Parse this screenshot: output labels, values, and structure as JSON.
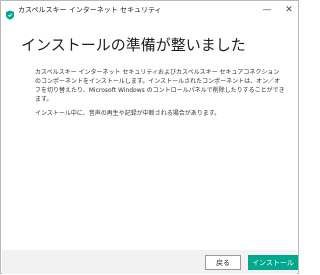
{
  "window": {
    "title": "カスペルスキー インターネット セキュリティ",
    "minimize_glyph": "—",
    "close_glyph": "✕"
  },
  "content": {
    "heading": "インストールの準備が整いました",
    "paragraph1": "カスペルスキー インターネット セキュリティおよびカスペルスキー セキュアコネクションのコンポーネントをインストールします。インストールされたコンポーネントは、オン／オフを切り替えたり、Microsoft Windows のコントロールパネルで削除したりすることができます。",
    "paragraph2": "インストール中に、音声の再生や記録が中断される場合があります。"
  },
  "footer": {
    "back_label": "戻る",
    "install_label": "インストール"
  },
  "colors": {
    "accent": "#00a88e",
    "footer_bg": "#f2f2f2"
  },
  "icons": {
    "app": "kaspersky-shield-icon"
  }
}
